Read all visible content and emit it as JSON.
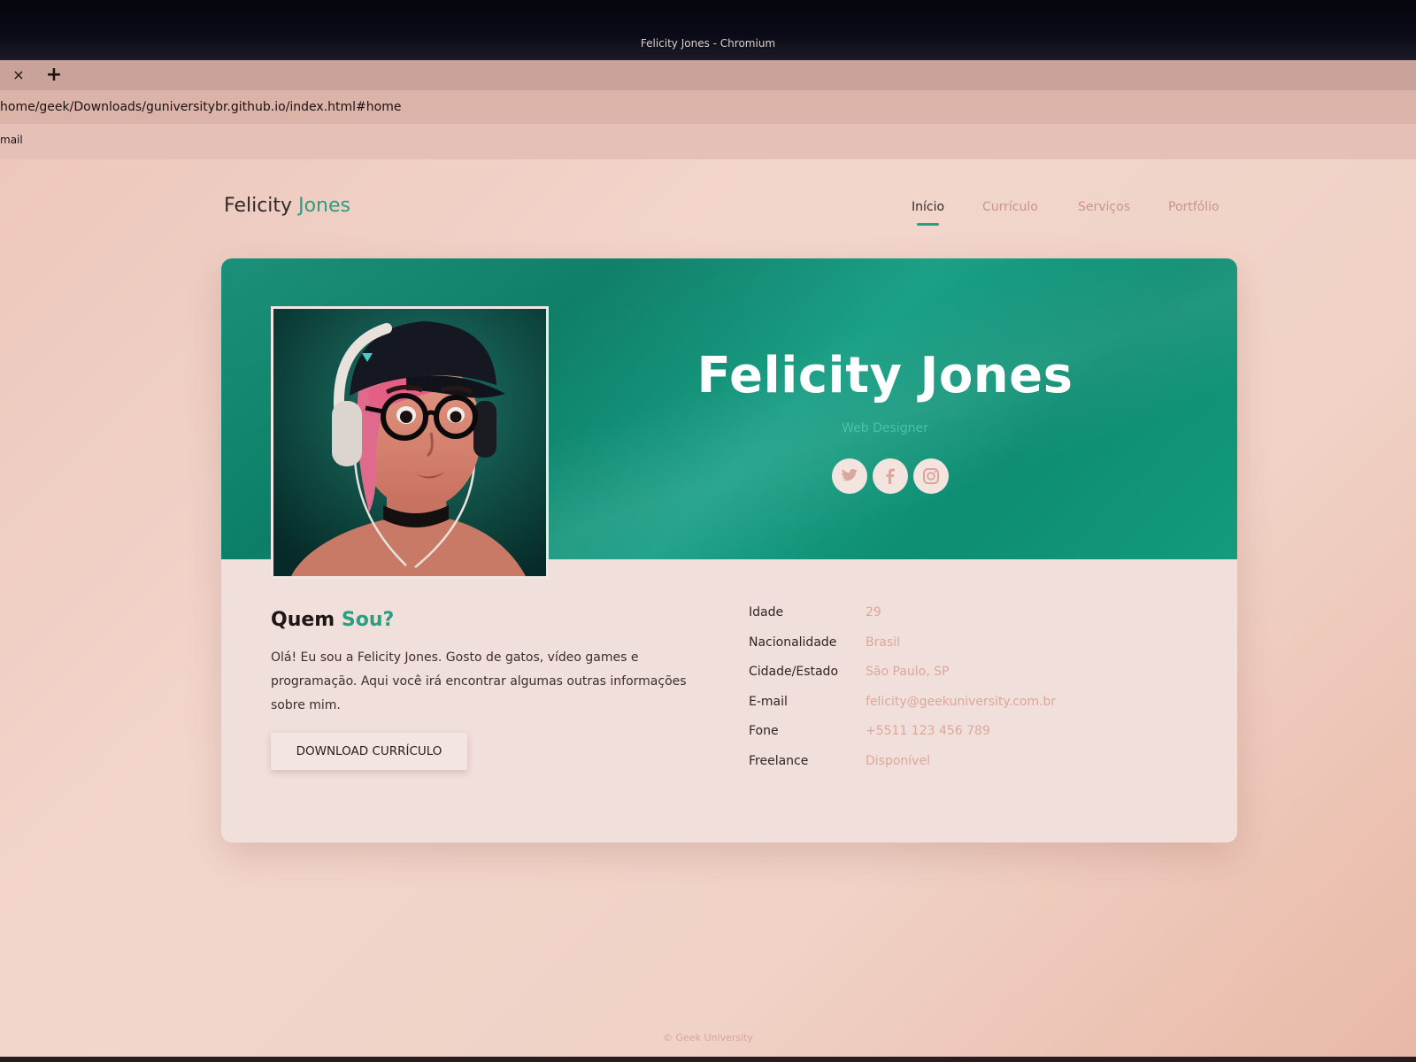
{
  "window": {
    "title": "Felicity Jones - Chromium",
    "tab_close": "×",
    "tab_new": "+"
  },
  "browser": {
    "url": "home/geek/Downloads/guniversitybr.github.io/index.html#home",
    "bookmark": "mail"
  },
  "site": {
    "logo": {
      "first": "Felicity",
      "second": "Jones"
    },
    "nav": [
      {
        "label": "Início",
        "active": true
      },
      {
        "label": "Currículo",
        "active": false
      },
      {
        "label": "Serviços",
        "active": false
      },
      {
        "label": "Portfólio",
        "active": false
      }
    ],
    "hero": {
      "name": "Felicity Jones",
      "role": "Web Designer",
      "socials": [
        "twitter-icon",
        "facebook-icon",
        "instagram-icon"
      ]
    },
    "about": {
      "title_first": "Quem",
      "title_second": "Sou?",
      "text": "Olá! Eu sou a Felicity Jones. Gosto de gatos, vídeo games e programação. Aqui você irá encontrar algumas outras informações sobre mim.",
      "button": "DOWNLOAD CURRÍCULO"
    },
    "info": [
      {
        "label": "Idade",
        "value": "29"
      },
      {
        "label": "Nacionalidade",
        "value": "Brasil"
      },
      {
        "label": "Cidade/Estado",
        "value": "São Paulo, SP"
      },
      {
        "label": "E-mail",
        "value": "felicity@geekuniversity.com.br"
      },
      {
        "label": "Fone",
        "value": "+5511 123 456 789"
      },
      {
        "label": "Freelance",
        "value": "Disponível"
      }
    ],
    "footer": "© Geek University"
  },
  "colors": {
    "accent": "#2a9e80",
    "banner": "#0f8a72",
    "value_text": "#dca79a"
  }
}
